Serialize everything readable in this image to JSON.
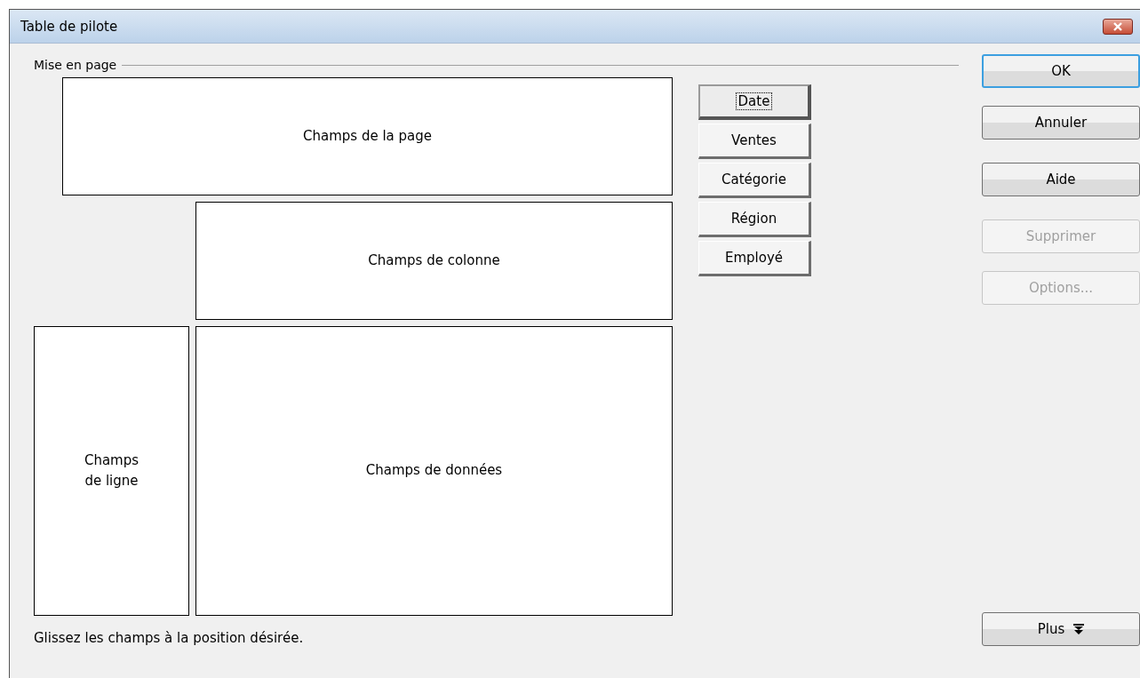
{
  "window": {
    "title": "Table de pilote"
  },
  "layout_group": {
    "label": "Mise en page"
  },
  "areas": [
    {
      "kind": "page",
      "label": "Champs de la page"
    },
    {
      "kind": "column",
      "label": "Champs de colonne"
    },
    {
      "kind": "row",
      "label": "Champs\nde ligne"
    },
    {
      "kind": "data",
      "label": "Champs de données"
    }
  ],
  "fields": [
    {
      "label": "Date",
      "selected": true
    },
    {
      "label": "Ventes",
      "selected": false
    },
    {
      "label": "Catégorie",
      "selected": false
    },
    {
      "label": "Région",
      "selected": false
    },
    {
      "label": "Employé",
      "selected": false
    }
  ],
  "buttons": [
    {
      "label": "OK",
      "default": true,
      "disabled": false
    },
    {
      "label": "Annuler",
      "default": false,
      "disabled": false
    },
    {
      "label": "Aide",
      "default": false,
      "disabled": false
    },
    {
      "label": "Supprimer",
      "default": false,
      "disabled": true
    },
    {
      "label": "Options...",
      "default": false,
      "disabled": true
    }
  ],
  "more_button": {
    "label": "Plus"
  },
  "hint": "Glissez les champs à la position désirée."
}
